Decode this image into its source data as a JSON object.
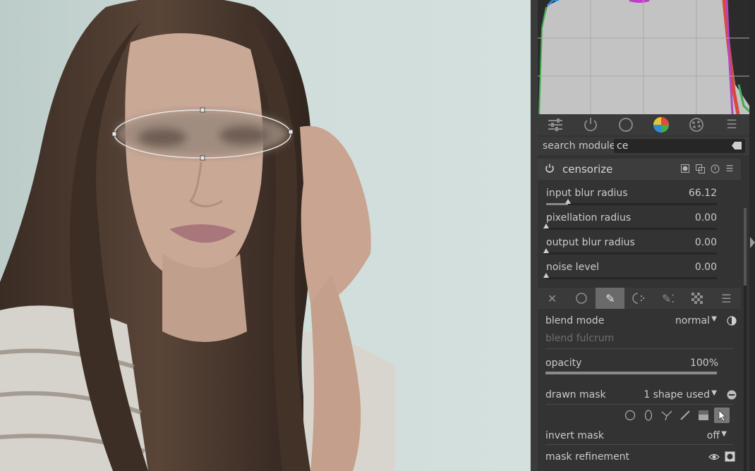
{
  "toolbar": {
    "icons": [
      "sliders-icon",
      "power-icon",
      "circle-icon",
      "color-wheel-icon",
      "palette-icon",
      "menu-icon"
    ]
  },
  "search": {
    "label": "search module",
    "value": "ce"
  },
  "module": {
    "title": "censorize",
    "sliders": [
      {
        "label": "input blur radius",
        "value": "66.12",
        "fraction": 0.13
      },
      {
        "label": "pixellation radius",
        "value": "0.00",
        "fraction": 0.0
      },
      {
        "label": "output blur radius",
        "value": "0.00",
        "fraction": 0.0
      },
      {
        "label": "noise level",
        "value": "0.00",
        "fraction": 0.0
      }
    ]
  },
  "blend": {
    "tabs": [
      "off",
      "uniformly",
      "drawn mask",
      "parametric mask",
      "drawn & parametric",
      "raster mask",
      "menu"
    ],
    "active_tab": 2,
    "blend_mode_label": "blend mode",
    "blend_mode_value": "normal",
    "blend_fulcrum_label": "blend fulcrum",
    "opacity_label": "opacity",
    "opacity_value": "100%",
    "opacity_fraction": 1.0,
    "drawn_mask_label": "drawn mask",
    "drawn_mask_value": "1 shape used",
    "invert_mask_label": "invert mask",
    "invert_mask_value": "off",
    "mask_refinement_label": "mask refinement"
  },
  "colors": {
    "accent": "#6a6a6a",
    "panel": "#333333",
    "histogram_fill": "#c3c3c3"
  }
}
